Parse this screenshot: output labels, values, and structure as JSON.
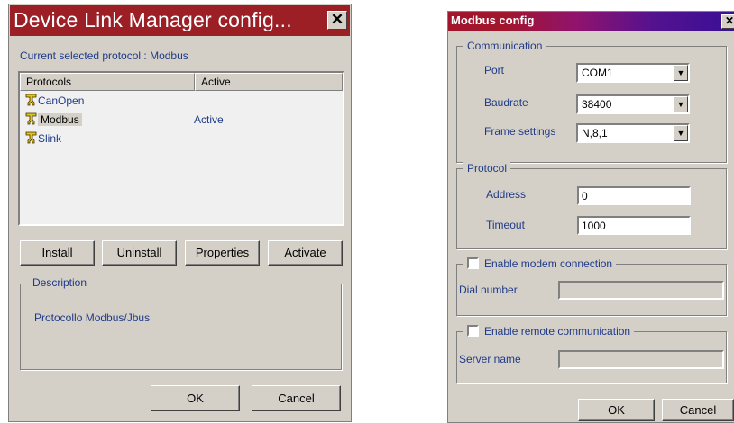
{
  "device_link": {
    "title": "Device Link Manager config...",
    "current_label": "Current selected protocol : Modbus",
    "columns": [
      "Protocols",
      "Active"
    ],
    "protocols": [
      {
        "name": "CanOpen",
        "active": ""
      },
      {
        "name": "Modbus",
        "active": "Active"
      },
      {
        "name": "Slink",
        "active": ""
      }
    ],
    "buttons": {
      "install": "Install",
      "uninstall": "Uninstall",
      "properties": "Properties",
      "activate": "Activate"
    },
    "description_label": "Description",
    "description_text": "Protocollo Modbus/Jbus",
    "ok": "OK",
    "cancel": "Cancel"
  },
  "modbus": {
    "title": "Modbus config",
    "communication_label": "Communication",
    "port_label": "Port",
    "port_value": "COM1",
    "baudrate_label": "Baudrate",
    "baudrate_value": "38400",
    "frame_label": "Frame settings",
    "frame_value": "N,8,1",
    "protocol_label": "Protocol",
    "address_label": "Address",
    "address_value": "0",
    "timeout_label": "Timeout",
    "timeout_value": "1000",
    "modem_label": "Enable modem connection",
    "dial_label": "Dial number",
    "remote_label": "Enable remote communication",
    "server_label": "Server name",
    "ok": "OK",
    "cancel": "Cancel"
  },
  "colors": {
    "title1": "#9c1f26",
    "face": "#d4d0c8",
    "text": "#1f3a88"
  },
  "icons": {
    "plug": "plug-icon",
    "close": "close-icon",
    "dropdown": "chevron-down-icon"
  }
}
